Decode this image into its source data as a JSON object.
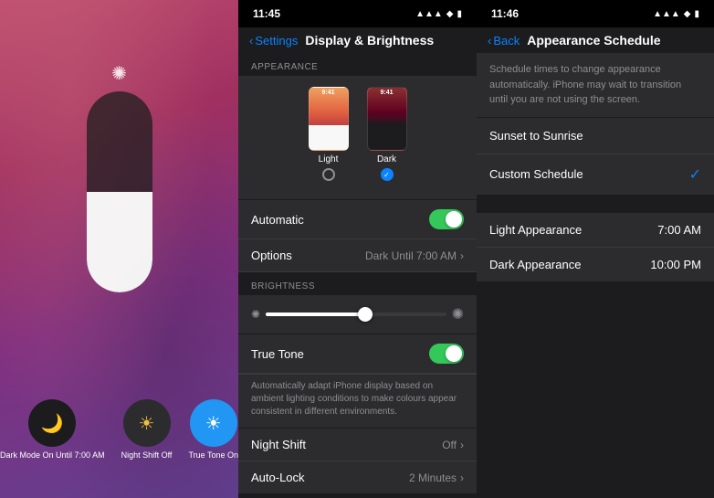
{
  "panel1": {
    "icons": [
      {
        "id": "dark-mode",
        "emoji": "🌙",
        "label": "Dark Mode\nOn Until\n7:00 AM",
        "type": "dark-mode"
      },
      {
        "id": "night-shift",
        "emoji": "☀",
        "label": "Night Shift\nOff",
        "type": "night-shift"
      },
      {
        "id": "true-tone",
        "emoji": "☀",
        "label": "True Tone\nOn",
        "type": "true-tone"
      }
    ]
  },
  "panel2": {
    "status": {
      "time": "11:45",
      "icons": "▲ ◆ ⬡"
    },
    "nav": {
      "back": "Settings",
      "title": "Display & Brightness"
    },
    "sections": {
      "appearance_header": "APPEARANCE",
      "light_label": "Light",
      "dark_label": "Dark",
      "automatic_label": "Automatic",
      "options_label": "Options",
      "options_value": "Dark Until 7:00 AM",
      "brightness_header": "BRIGHTNESS",
      "true_tone_label": "True Tone",
      "true_tone_desc": "Automatically adapt iPhone display based on ambient lighting conditions to make colours appear consistent in different environments.",
      "night_shift_label": "Night Shift",
      "night_shift_value": "Off",
      "auto_lock_label": "Auto-Lock",
      "auto_lock_value": "2 Minutes"
    }
  },
  "panel3": {
    "status": {
      "time": "11:46",
      "icons": "▲ ◆ ⬡"
    },
    "nav": {
      "back": "Back",
      "title": "Appearance Schedule"
    },
    "description": "Schedule times to change appearance automatically. iPhone may wait to transition until you are not using the screen.",
    "options": [
      {
        "label": "Sunset to Sunrise",
        "selected": false
      },
      {
        "label": "Custom Schedule",
        "selected": true
      }
    ],
    "times": [
      {
        "label": "Light Appearance",
        "value": "7:00 AM"
      },
      {
        "label": "Dark Appearance",
        "value": "10:00 PM"
      }
    ]
  }
}
